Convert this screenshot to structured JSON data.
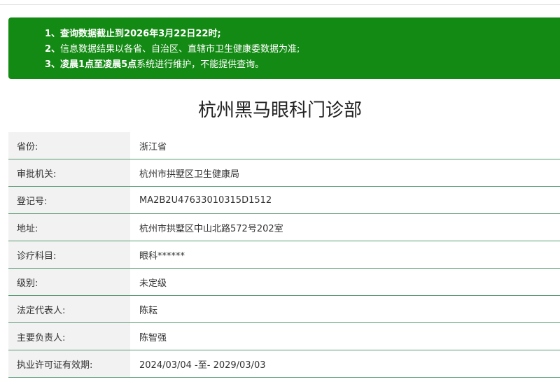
{
  "notice": {
    "lines": [
      {
        "prefix": "1、",
        "bold": "",
        "text": "查询数据截止到2026年3月22日22时;"
      },
      {
        "prefix": "2、",
        "bold": "",
        "text": "信息数据结果以各省、自治区、直辖市卫生健康委数据为准;"
      },
      {
        "prefix": "3、",
        "bold": "凌晨1点至凌晨5点",
        "text": "系统进行维护，不能提供查询。"
      }
    ]
  },
  "title": "杭州黑马眼科门诊部",
  "rows": [
    {
      "label": "省份:",
      "value": "浙江省"
    },
    {
      "label": "审批机关:",
      "value": "杭州市拱墅区卫生健康局"
    },
    {
      "label": "登记号:",
      "value": "MA2B2U47633010315D1512"
    },
    {
      "label": "地址:",
      "value": "杭州市拱墅区中山北路572号202室"
    },
    {
      "label": "诊疗科目:",
      "value": "眼科******"
    },
    {
      "label": "级别:",
      "value": "未定级"
    },
    {
      "label": "法定代表人:",
      "value": "陈耘"
    },
    {
      "label": "主要负责人:",
      "value": "陈智强"
    },
    {
      "label": "执业许可证有效期:",
      "value": "2024/03/04 -至- 2029/03/03"
    }
  ],
  "colors": {
    "notice_bg": "#138a13",
    "row_divider": "#5a9a74",
    "label_bg": "#f2f2f2"
  }
}
